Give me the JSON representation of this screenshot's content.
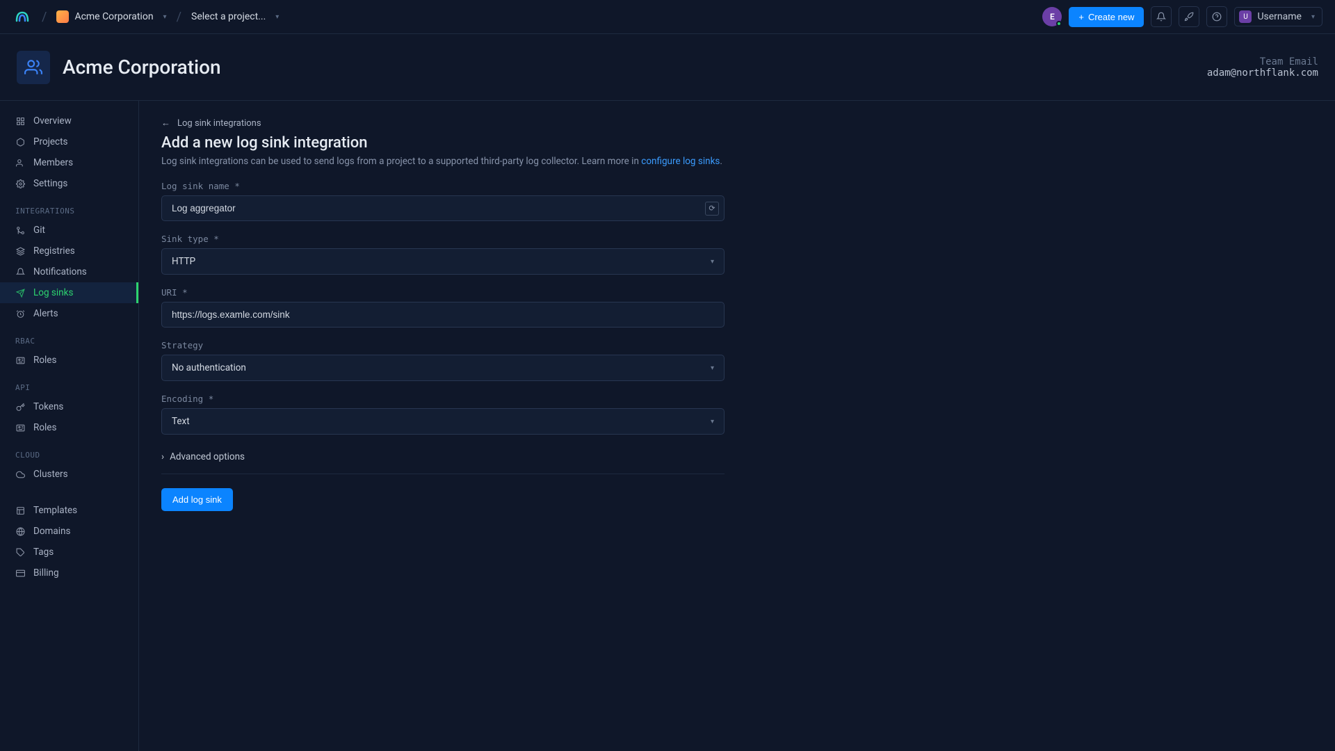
{
  "topbar": {
    "team": "Acme Corporation",
    "project_placeholder": "Select a project...",
    "avatar_letter": "E",
    "create_label": "Create new",
    "username": "Username",
    "user_letter": "U"
  },
  "header": {
    "title": "Acme Corporation",
    "email_label": "Team Email",
    "email_value": "adam@northflank.com"
  },
  "sidebar": {
    "main": [
      {
        "id": "overview",
        "label": "Overview",
        "icon": "grid"
      },
      {
        "id": "projects",
        "label": "Projects",
        "icon": "hexagon"
      },
      {
        "id": "members",
        "label": "Members",
        "icon": "users"
      },
      {
        "id": "settings",
        "label": "Settings",
        "icon": "gear"
      }
    ],
    "sections": [
      {
        "title": "INTEGRATIONS",
        "items": [
          {
            "id": "git",
            "label": "Git",
            "icon": "git"
          },
          {
            "id": "registries",
            "label": "Registries",
            "icon": "layers"
          },
          {
            "id": "notifications",
            "label": "Notifications",
            "icon": "bell"
          },
          {
            "id": "logsinks",
            "label": "Log sinks",
            "icon": "send",
            "active": true
          },
          {
            "id": "alerts",
            "label": "Alerts",
            "icon": "alarm"
          }
        ]
      },
      {
        "title": "RBAC",
        "items": [
          {
            "id": "rbac-roles",
            "label": "Roles",
            "icon": "id"
          }
        ]
      },
      {
        "title": "API",
        "items": [
          {
            "id": "tokens",
            "label": "Tokens",
            "icon": "key"
          },
          {
            "id": "api-roles",
            "label": "Roles",
            "icon": "id"
          }
        ]
      },
      {
        "title": "CLOUD",
        "items": [
          {
            "id": "clusters",
            "label": "Clusters",
            "icon": "cloud"
          }
        ]
      },
      {
        "title": "",
        "items": [
          {
            "id": "templates",
            "label": "Templates",
            "icon": "template"
          },
          {
            "id": "domains",
            "label": "Domains",
            "icon": "globe"
          },
          {
            "id": "tags",
            "label": "Tags",
            "icon": "tag"
          },
          {
            "id": "billing",
            "label": "Billing",
            "icon": "card"
          }
        ]
      }
    ]
  },
  "page": {
    "back": "Log sink integrations",
    "title": "Add a new log sink integration",
    "description": "Log sink integrations can be used to send logs from a project to a supported third-party log collector. Learn more in ",
    "link": "configure log sinks",
    "fields": {
      "name_label": "Log sink name *",
      "name_value": "Log aggregator",
      "type_label": "Sink type *",
      "type_value": "HTTP",
      "uri_label": "URI *",
      "uri_value": "https://logs.examle.com/sink",
      "strategy_label": "Strategy",
      "strategy_value": "No authentication",
      "encoding_label": "Encoding *",
      "encoding_value": "Text"
    },
    "advanced": "Advanced options",
    "submit": "Add log sink"
  }
}
